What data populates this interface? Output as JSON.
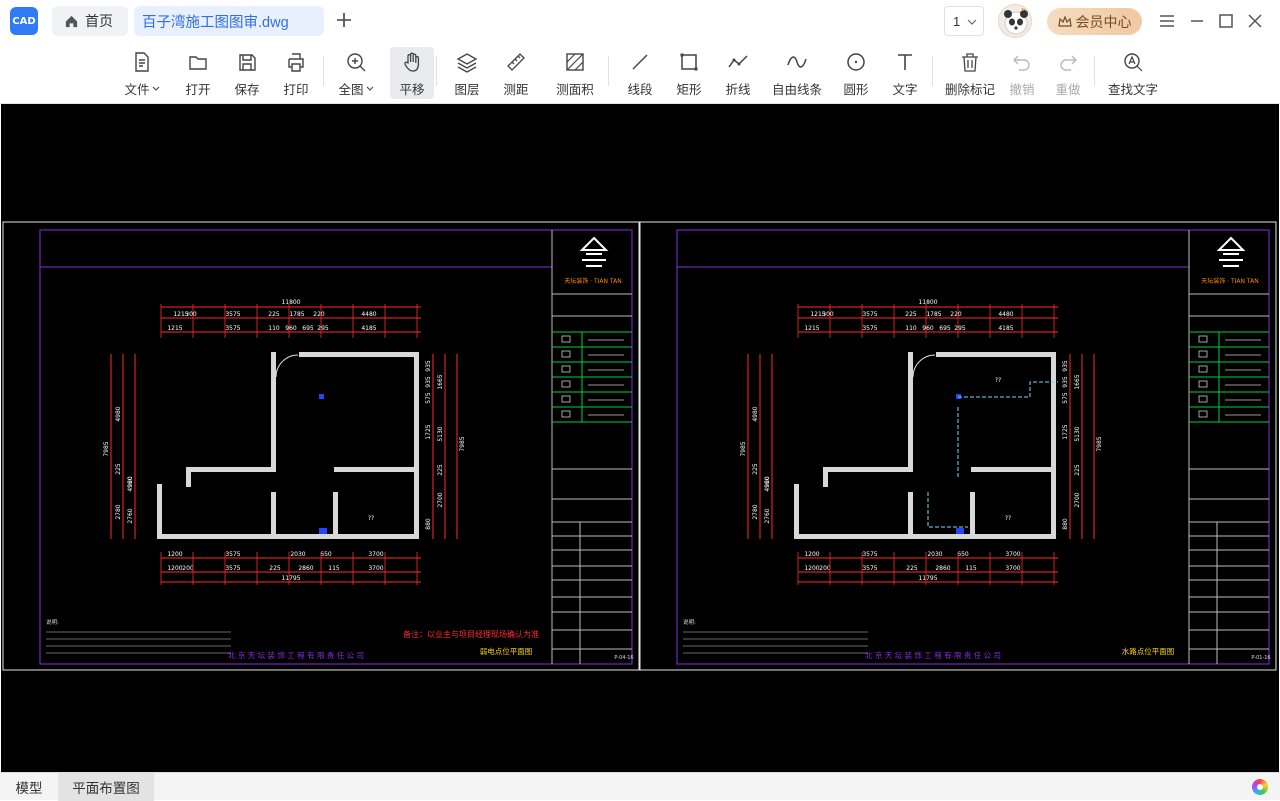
{
  "app": {
    "logo_text": "CAD"
  },
  "tabs": {
    "home_label": "首页",
    "file_label": "百子湾施工图图审.dwg"
  },
  "page_selector": {
    "value": "1"
  },
  "vip": {
    "label": "会员中心"
  },
  "toolbar": [
    {
      "id": "file",
      "label": "文件",
      "icon": "file-icon",
      "dropdown": true
    },
    {
      "id": "open",
      "label": "打开",
      "icon": "folder-icon"
    },
    {
      "id": "save",
      "label": "保存",
      "icon": "save-icon"
    },
    {
      "id": "print",
      "label": "打印",
      "icon": "print-icon"
    },
    {
      "id": "fullview",
      "label": "全图",
      "icon": "fullview-icon",
      "dropdown": true
    },
    {
      "id": "pan",
      "label": "平移",
      "icon": "hand-icon",
      "active": true
    },
    {
      "id": "layers",
      "label": "图层",
      "icon": "layers-icon"
    },
    {
      "id": "measure-dist",
      "label": "测距",
      "icon": "ruler-icon"
    },
    {
      "id": "measure-area",
      "label": "测面积",
      "icon": "area-icon"
    },
    {
      "id": "line",
      "label": "线段",
      "icon": "line-icon"
    },
    {
      "id": "rect",
      "label": "矩形",
      "icon": "rect-icon"
    },
    {
      "id": "polyline",
      "label": "折线",
      "icon": "polyline-icon"
    },
    {
      "id": "freeline",
      "label": "自由线条",
      "icon": "freeline-icon"
    },
    {
      "id": "circle",
      "label": "圆形",
      "icon": "circle-icon"
    },
    {
      "id": "text",
      "label": "文字",
      "icon": "text-icon"
    },
    {
      "id": "delete-marks",
      "label": "删除标记",
      "icon": "trash-icon"
    },
    {
      "id": "undo",
      "label": "撤销",
      "icon": "undo-icon",
      "disabled": true
    },
    {
      "id": "redo",
      "label": "重做",
      "icon": "redo-icon",
      "disabled": true
    },
    {
      "id": "find-text",
      "label": "查找文字",
      "icon": "find-text-icon"
    }
  ],
  "drawing": {
    "company": "北 京 天 坛 装 饰 工 程 有 限 责 任 公 司",
    "brand": "天坛装饰 · TIAN TAN",
    "sheets": [
      {
        "title": "弱电点位平面图",
        "remark": "备注：以业主与项目经理现场确认为准",
        "sheet_no": "P-04-16",
        "dims_top_total": "11800",
        "dims_top_1": [
          "1215",
          "300",
          "3575",
          "225",
          "1785",
          "220",
          "4480"
        ],
        "dims_top_2": [
          "1215",
          "3575",
          "110",
          "960",
          "695",
          "295",
          "4185"
        ],
        "dims_bottom_1": [
          "1200",
          "3575",
          "2030",
          "650",
          "3700"
        ],
        "dims_bottom_2": [
          "1200",
          "200",
          "3575",
          "225",
          "2860",
          "115",
          "3700"
        ],
        "dims_bottom_total": "11795",
        "dims_left": [
          "7985",
          "4980",
          "4960",
          "225",
          "920",
          "2780",
          "2760"
        ],
        "dims_right": [
          "935",
          "935",
          "575",
          "1665",
          "1725",
          "5130",
          "225",
          "2700",
          "880",
          "7985"
        ]
      },
      {
        "title": "水路点位平面图",
        "remark": "",
        "sheet_no": "P-01-16",
        "dims_top_total": "11800",
        "dims_top_1": [
          "1215",
          "300",
          "3575",
          "225",
          "1785",
          "220",
          "4480"
        ],
        "dims_top_2": [
          "1215",
          "3575",
          "110",
          "960",
          "695",
          "295",
          "4185"
        ],
        "dims_bottom_1": [
          "1200",
          "3575",
          "2030",
          "650",
          "3700"
        ],
        "dims_bottom_2": [
          "1200",
          "200",
          "3575",
          "225",
          "2860",
          "115",
          "3700"
        ],
        "dims_bottom_total": "11795",
        "dims_left": [
          "7985",
          "4980",
          "4960",
          "225",
          "920",
          "2780",
          "2760"
        ],
        "dims_right": [
          "935",
          "935",
          "575",
          "1665",
          "1725",
          "5130",
          "225",
          "2700",
          "880",
          "7985"
        ]
      }
    ]
  },
  "bottom_tabs": {
    "model": "模型",
    "layout": "平面布置图"
  },
  "colors": {
    "accent": "#2f7bf5",
    "dim": "#ff2a2a",
    "frame": "#8a2be2",
    "wall": "#d8d8d8",
    "legend": "#00d23a",
    "logo": "#ff8a00"
  }
}
